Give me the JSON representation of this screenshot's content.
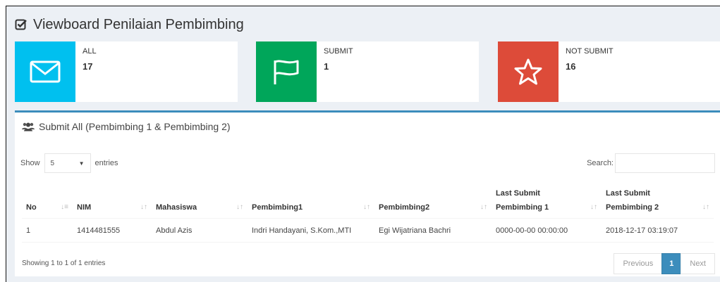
{
  "page": {
    "title": "Viewboard Penilaian Pembimbing"
  },
  "info_boxes": [
    {
      "label": "ALL",
      "value": "17",
      "icon": "envelope-icon",
      "color": "#00c0ef"
    },
    {
      "label": "SUBMIT",
      "value": "1",
      "icon": "flag-icon",
      "color": "#00a65a"
    },
    {
      "label": "NOT SUBMIT",
      "value": "16",
      "icon": "star-icon",
      "color": "#dd4b39"
    }
  ],
  "box": {
    "title": "Submit All (Pembimbing 1 & Pembimbing 2)",
    "accent": "#3c8dbc"
  },
  "length_menu": {
    "prefix": "Show",
    "selected": "5",
    "suffix": "entries"
  },
  "search": {
    "label": "Search:",
    "value": "",
    "placeholder": ""
  },
  "table": {
    "headers": [
      "No",
      "NIM",
      "Mahasiswa",
      "Pembimbing1",
      "Pembimbing2",
      [
        "Last Submit",
        "Pembimbing 1"
      ],
      [
        "Last Submit",
        "Pembimbing 2"
      ]
    ],
    "rows": [
      [
        "1",
        "1414481555",
        "Abdul Azis",
        "Indri Handayani, S.Kom.,MTI",
        "Egi Wijatriana Bachri",
        "0000-00-00 00:00:00",
        "2018-12-17 03:19:07"
      ]
    ]
  },
  "footer": {
    "info": "Showing 1 to 1 of 1 entries"
  },
  "pagination": {
    "previous": "Previous",
    "current": "1",
    "next": "Next"
  }
}
